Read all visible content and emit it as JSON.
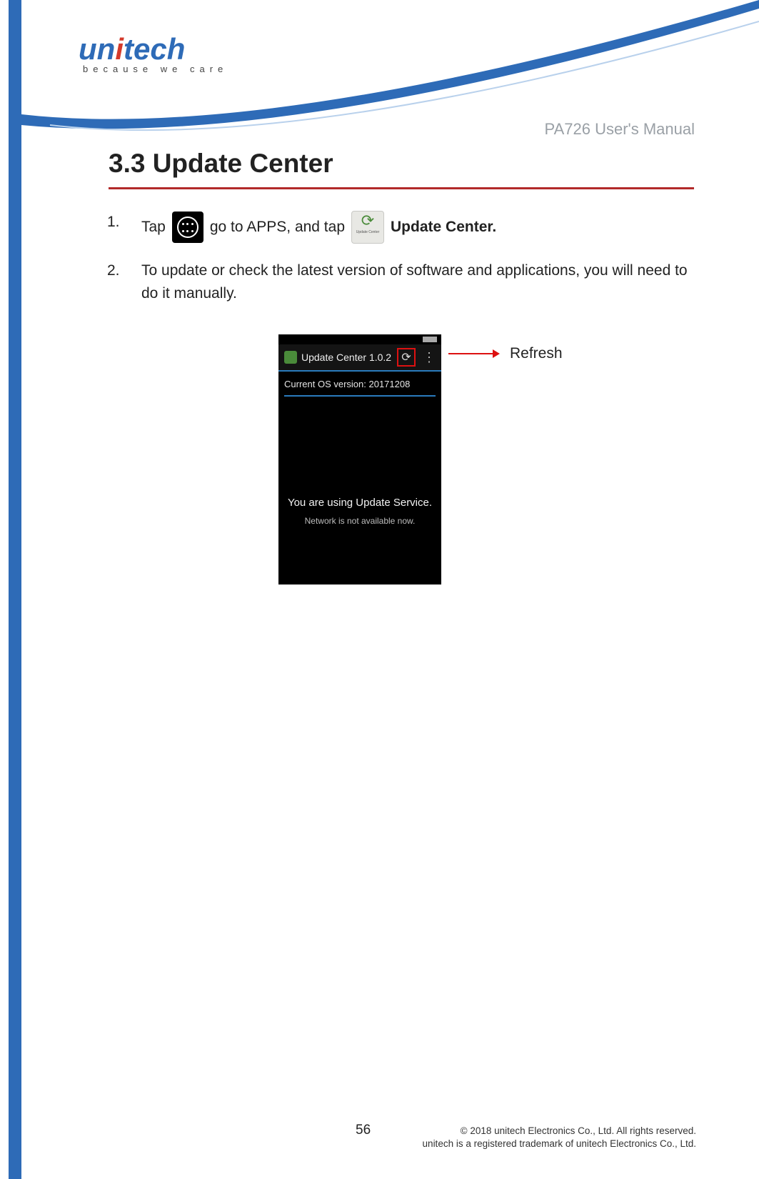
{
  "logo": {
    "brand": "unitech",
    "tagline": "because we care"
  },
  "manual_title": "PA726 User's Manual",
  "section_heading": "3.3 Update Center",
  "step1": {
    "num": "1.",
    "t_tap": "Tap",
    "t_go": "go to APPS, and tap",
    "t_uc": "Update Center.",
    "uc_icon_label": "Update Center"
  },
  "step2": {
    "num": "2.",
    "text": "To update or check the latest version of software and applications, you will need to do it manually."
  },
  "phone": {
    "titlebar": "Update Center 1.0.2",
    "current_os": "Current OS version: 20171208",
    "mid1": "You are using Update Service.",
    "mid2": "Network is not available now."
  },
  "callout_label": "Refresh",
  "footer": {
    "page": "56",
    "c1": "© 2018 unitech Electronics Co., Ltd. All rights reserved.",
    "c2": "unitech is a registered trademark of unitech Electronics Co., Ltd."
  }
}
